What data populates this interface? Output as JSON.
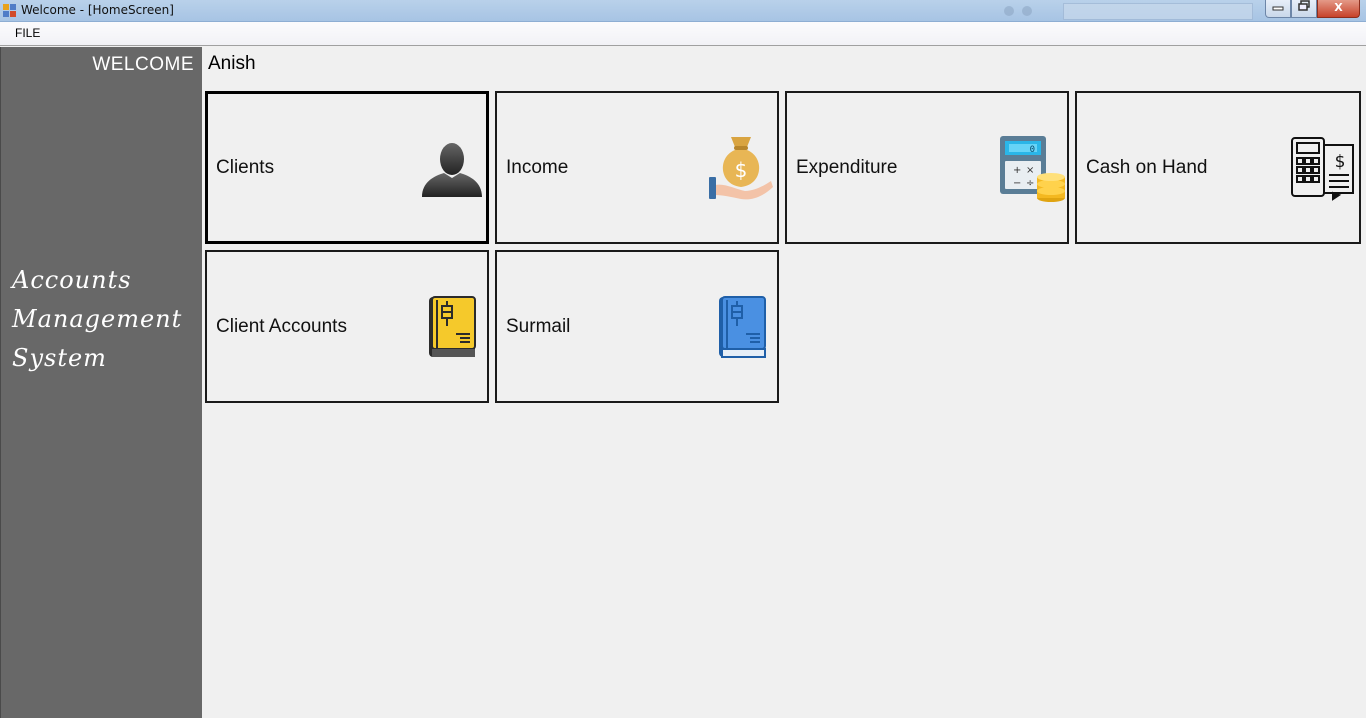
{
  "window": {
    "title": "Welcome - [HomeScreen]",
    "controls": {
      "minimize": "▭",
      "maximize": "▢",
      "close": "X"
    }
  },
  "menu": {
    "file": "FILE"
  },
  "sidebar": {
    "welcome": "WELCOME",
    "app_name_lines": [
      "Accounts",
      "Management",
      "System"
    ]
  },
  "user": {
    "name": "Anish"
  },
  "tiles": [
    {
      "label": "Clients",
      "icon": "person-silhouette-icon"
    },
    {
      "label": "Income",
      "icon": "money-bag-hand-icon"
    },
    {
      "label": "Expenditure",
      "icon": "calculator-coins-icon"
    },
    {
      "label": "Cash on Hand",
      "icon": "cash-register-icon"
    },
    {
      "label": "Client Accounts",
      "icon": "yellow-ledger-book-icon"
    },
    {
      "label": "Surmail",
      "icon": "blue-ledger-book-icon"
    }
  ],
  "colors": {
    "sidebar": "#686868",
    "background": "#f0f0f0",
    "titlebar": "#b9d1ea",
    "ledger_yellow": "#f5c92b",
    "ledger_blue": "#4a90e2"
  }
}
